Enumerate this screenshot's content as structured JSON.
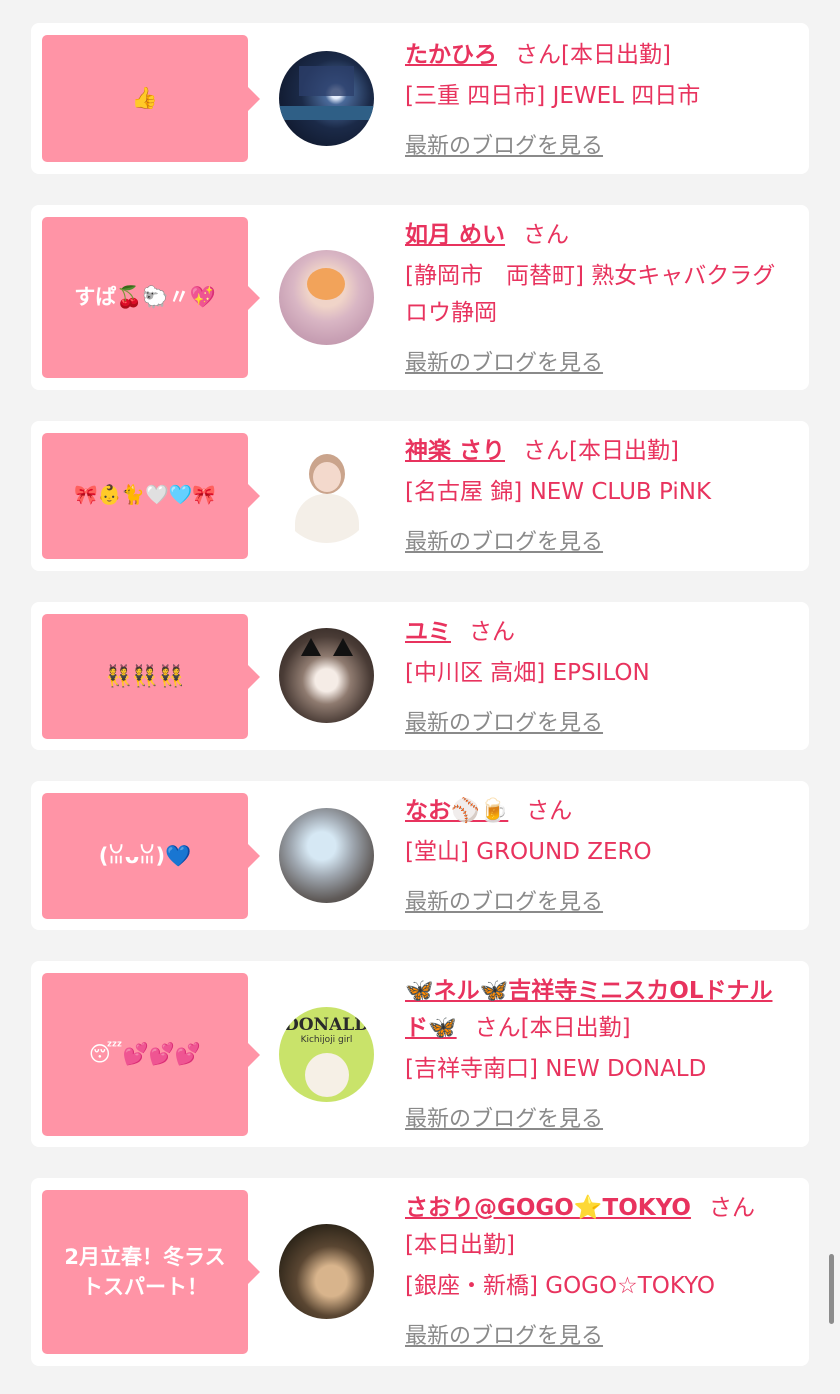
{
  "posts": [
    {
      "bubble": "👍",
      "name": "たかひろ",
      "honorific": "さん",
      "status": "[本日出勤]",
      "shop": "[三重 四日市] JEWEL 四日市",
      "blog_link": "最新のブログを見る",
      "avatar": "avatar-night-city-image"
    },
    {
      "bubble": "すぱ🍒🐑〃💖",
      "name": "如月 めい",
      "honorific": "さん",
      "status": "",
      "shop": "[静岡市　両替町] 熟女キャバクラグロウ静岡",
      "blog_link": "最新のブログを見る",
      "avatar": "avatar-cat-filter-photo"
    },
    {
      "bubble": "🎀👶🐈🤍🩵🎀",
      "name": "神楽 さり",
      "honorific": "さん",
      "status": "[本日出勤]",
      "shop": "[名古屋 錦] NEW CLUB PiNK",
      "blog_link": "最新のブログを見る",
      "avatar": "avatar-woman-white-top-photo"
    },
    {
      "bubble": "👯👯👯",
      "name": "ユミ",
      "honorific": "さん",
      "status": "",
      "shop": "[中川区 高畑] EPSILON",
      "blog_link": "最新のブログを見る",
      "avatar": "avatar-cat-ears-photo"
    },
    {
      "bubble": "(ꈍᴗꈍ)💙",
      "name": "なお⚾️🍺",
      "honorific": "さん",
      "status": "",
      "shop": "[堂山] GROUND ZERO",
      "blog_link": "最新のブログを見る",
      "avatar": "avatar-blurred-face-photo"
    },
    {
      "bubble": "😴💕💕💕",
      "name": "🦋ネル🦋吉祥寺ミニスカOLドナルド🦋",
      "honorific": "さん",
      "status": "[本日出勤]",
      "shop": "[吉祥寺南口] NEW DONALD",
      "blog_link": "最新のブログを見る",
      "avatar": "avatar-donald-yellow-photo",
      "avatar_text": "DONALD",
      "avatar_subtext": "Kichijoji girl"
    },
    {
      "bubble": "2月立春！冬ラストスパート！",
      "name": "さおり@GOGO⭐TOKYO",
      "honorific": "さん",
      "status": "[本日出勤]",
      "shop": "[銀座・新橋] GOGO☆TOKYO",
      "blog_link": "最新のブログを見る",
      "avatar": "avatar-dark-seated-photo"
    }
  ],
  "colors": {
    "accent": "#e8335e",
    "bubble": "#ff94a6",
    "link_gray": "#8a8a8a",
    "background": "#f3f3f3"
  }
}
